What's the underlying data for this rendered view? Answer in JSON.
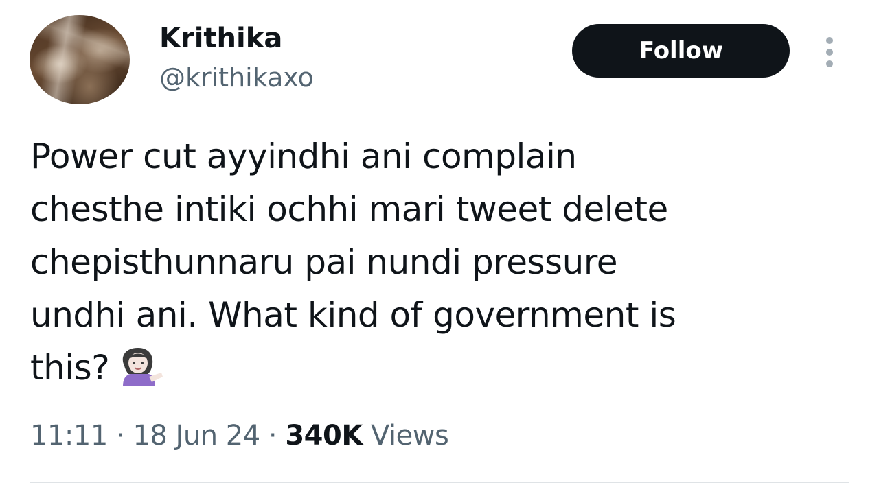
{
  "author": {
    "display_name": "Krithika",
    "handle": "@krithikaxo"
  },
  "follow_label": "Follow",
  "tweet": {
    "text_lines": [
      "Power cut ayyindhi ani complain",
      "chesthe intiki ochhi mari tweet delete",
      "chepisthunnaru pai nundi pressure",
      "undhi ani. What kind of government is",
      "this?"
    ],
    "emoji": "person-tipping-hand-emoji"
  },
  "meta": {
    "time": "11:11",
    "separator": "·",
    "date": "18 Jun 24",
    "views_count": "340K",
    "views_label": "Views"
  },
  "colors": {
    "text_primary": "#0f1419",
    "text_secondary": "#536471",
    "button_bg": "#0f1419",
    "button_text": "#ffffff"
  }
}
